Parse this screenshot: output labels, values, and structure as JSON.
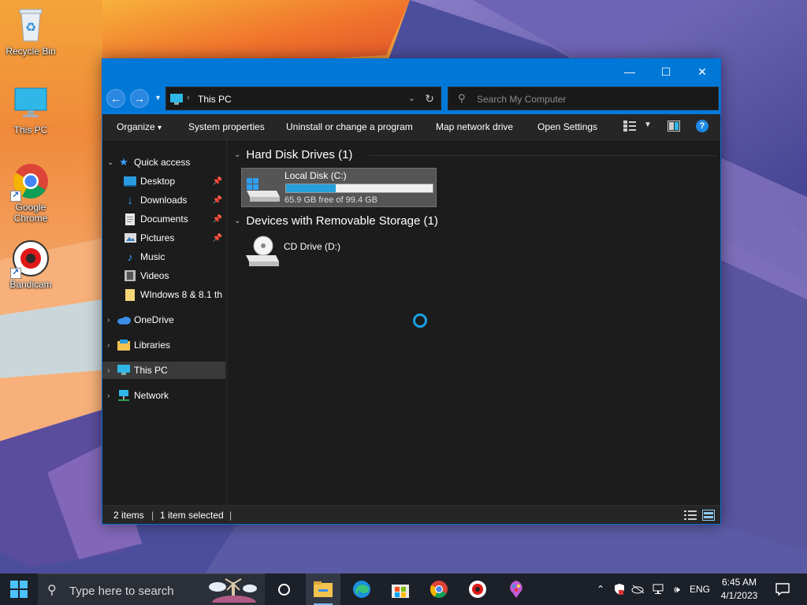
{
  "desktop": {
    "icons": [
      {
        "label": "Recycle Bin",
        "icon": "recycle-bin-icon"
      },
      {
        "label": "This PC",
        "icon": "monitor-icon"
      },
      {
        "label": "Google Chrome",
        "icon": "chrome-icon"
      },
      {
        "label": "Bandicam",
        "icon": "bandicam-icon"
      }
    ]
  },
  "window": {
    "controls": {
      "minimize": "—",
      "maximize": "☐",
      "close": "✕"
    },
    "address": {
      "path": "This PC",
      "separator": "›"
    },
    "search": {
      "placeholder": "Search My Computer"
    },
    "commands": [
      "Organize",
      "System properties",
      "Uninstall or change a program",
      "Map network drive",
      "Open Settings"
    ],
    "organize_arrow": "▾",
    "help_label": "?",
    "nav": {
      "quick_access": "Quick access",
      "items": [
        {
          "label": "Desktop",
          "pinned": true
        },
        {
          "label": "Downloads",
          "pinned": true
        },
        {
          "label": "Documents",
          "pinned": true
        },
        {
          "label": "Pictures",
          "pinned": true
        },
        {
          "label": "Music",
          "pinned": false
        },
        {
          "label": "Videos",
          "pinned": false
        },
        {
          "label": "WIndows 8 & 8.1 th",
          "pinned": false
        }
      ],
      "roots": [
        "OneDrive",
        "Libraries",
        "This PC",
        "Network"
      ],
      "selected": "This PC"
    },
    "groups": [
      {
        "title": "Hard Disk Drives (1)"
      },
      {
        "title": "Devices with Removable Storage (1)"
      }
    ],
    "drives": {
      "c": {
        "name": "Local Disk (C:)",
        "free": "65.9 GB free of 99.4 GB",
        "used_fraction": 0.337
      },
      "d": {
        "name": "CD Drive (D:)"
      }
    },
    "status": {
      "items": "2 items",
      "selected": "1 item selected",
      "sep": "|"
    }
  },
  "taskbar": {
    "search_placeholder": "Type here to search",
    "apps": [
      "task-view-icon",
      "file-explorer-icon",
      "edge-icon",
      "store-icon",
      "chrome-icon",
      "bandicam-icon",
      "paint-icon"
    ],
    "language": "ENG",
    "time": "6:45 AM",
    "date": "4/1/2023"
  },
  "colors": {
    "accent": "#0078d7",
    "window_bg": "#1c1c1c",
    "taskbar": "#1c2029"
  }
}
